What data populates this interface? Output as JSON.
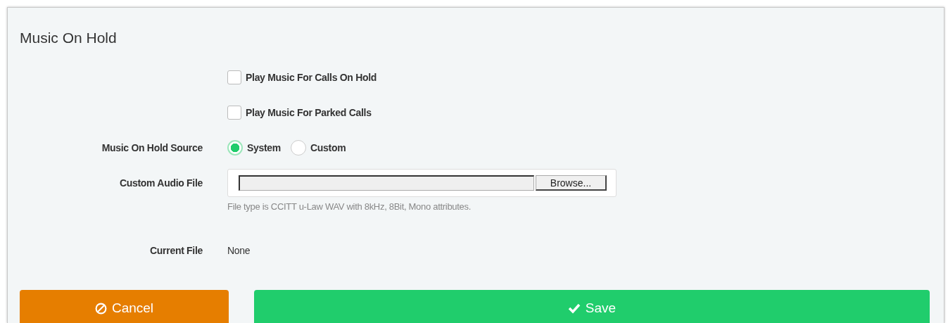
{
  "panel": {
    "title": "Music On Hold"
  },
  "checkboxes": [
    {
      "label": "Play Music For Calls On Hold",
      "checked": false
    },
    {
      "label": "Play Music For Parked Calls",
      "checked": false
    }
  ],
  "source": {
    "label": "Music On Hold Source",
    "options": [
      {
        "label": "System",
        "selected": true
      },
      {
        "label": "Custom",
        "selected": false
      }
    ]
  },
  "audio_file": {
    "label": "Custom Audio File",
    "button": "Browse...",
    "hint": "File type is CCITT u-Law WAV with 8kHz, 8Bit, Mono attributes."
  },
  "current_file": {
    "label": "Current File",
    "value": "None"
  },
  "buttons": [
    {
      "label": "Cancel",
      "kind": "cancel"
    },
    {
      "label": "Save",
      "kind": "save"
    }
  ]
}
